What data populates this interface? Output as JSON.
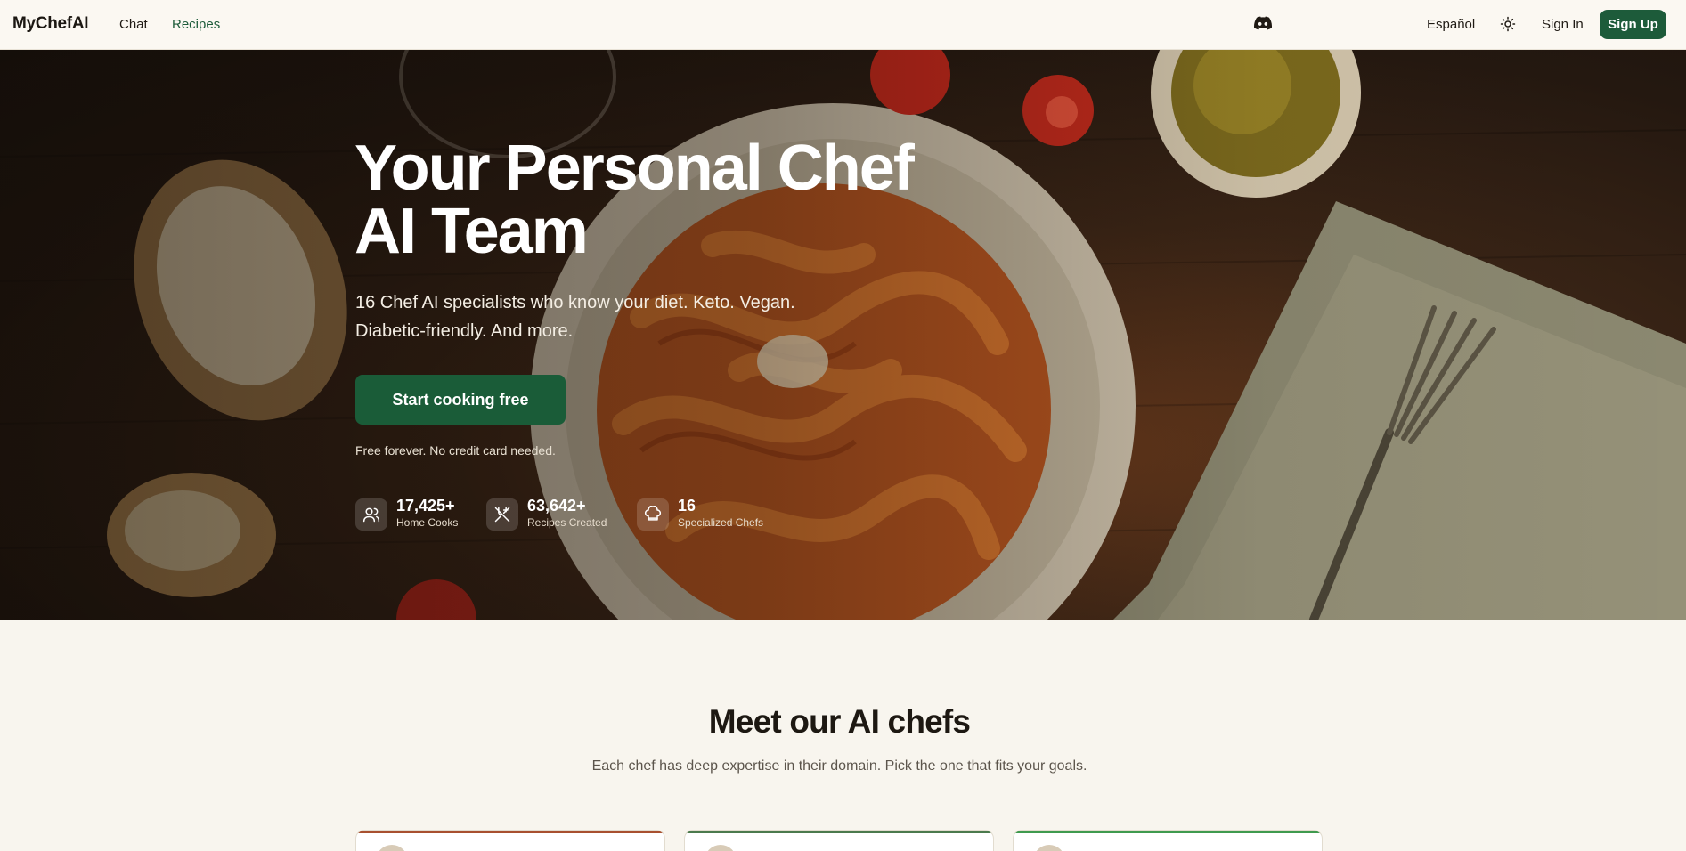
{
  "nav": {
    "logo": "MyChefAI",
    "links": [
      {
        "label": "Chat"
      },
      {
        "label": "Recipes"
      }
    ],
    "language": "Español",
    "sign_in": "Sign In",
    "sign_up": "Sign Up",
    "icons": {
      "community": "discord-icon",
      "theme": "sun-icon"
    }
  },
  "hero": {
    "title_line1": "Your Personal Chef",
    "title_line2": "AI Team",
    "subtitle": "16 Chef AI specialists who know your diet. Keto. Vegan. Diabetic-friendly. And more.",
    "cta": "Start cooking free",
    "note": "Free forever. No credit card needed.",
    "stats": [
      {
        "value": "17,425+",
        "label": "Home Cooks",
        "icon": "users-icon"
      },
      {
        "value": "63,642+",
        "label": "Recipes Created",
        "icon": "utensils-icon"
      },
      {
        "value": "16",
        "label": "Specialized Chefs",
        "icon": "chef-hat-icon"
      }
    ]
  },
  "chefs_section": {
    "title": "Meet our AI chefs",
    "subtitle": "Each chef has deep expertise in their domain. Pick the one that fits your goals.",
    "card_accents": [
      "#a8502f",
      "#4b7a4d",
      "#3f9a4e"
    ]
  },
  "colors": {
    "brand": "#1d5b3a",
    "background": "#f8f5ee"
  }
}
